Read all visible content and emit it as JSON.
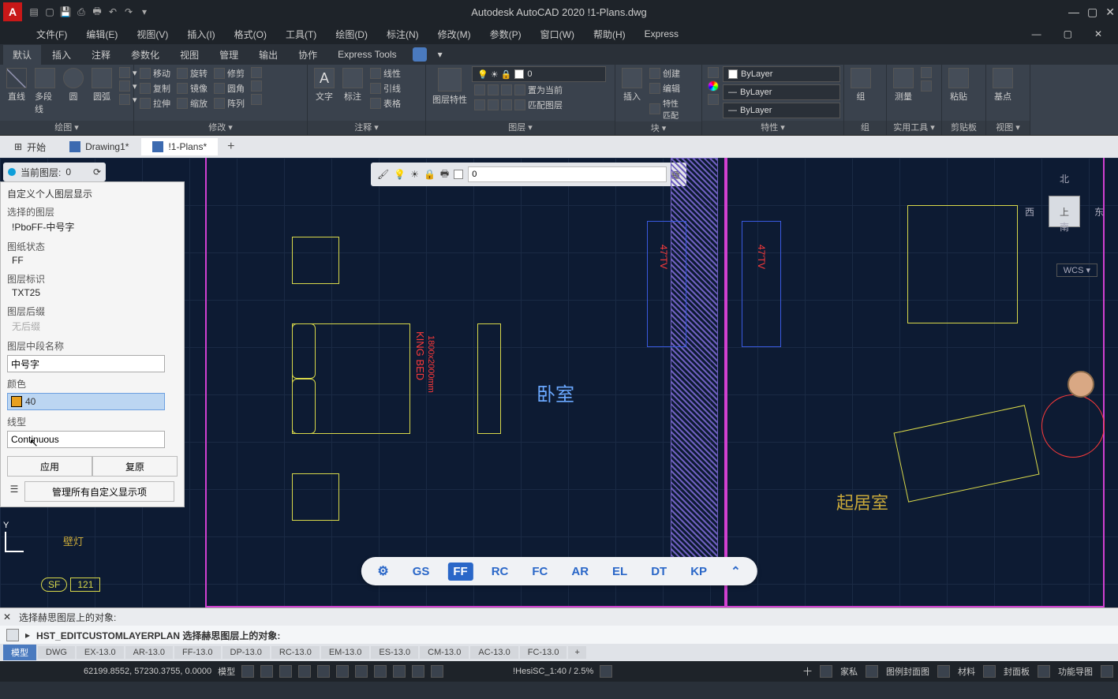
{
  "app": {
    "title": "Autodesk AutoCAD 2020   !1-Plans.dwg"
  },
  "menu": {
    "items": [
      "文件(F)",
      "编辑(E)",
      "视图(V)",
      "插入(I)",
      "格式(O)",
      "工具(T)",
      "绘图(D)",
      "标注(N)",
      "修改(M)",
      "参数(P)",
      "窗口(W)",
      "帮助(H)",
      "Express"
    ]
  },
  "ribbonTabs": [
    "默认",
    "插入",
    "注释",
    "参数化",
    "视图",
    "管理",
    "输出",
    "协作",
    "Express Tools"
  ],
  "panels": {
    "draw": {
      "label": "绘图 ▾",
      "items": [
        "直线",
        "多段线",
        "圆",
        "圆弧"
      ]
    },
    "modify": {
      "label": "修改 ▾",
      "items": [
        "移动",
        "复制",
        "拉伸",
        "旋转",
        "镜像",
        "缩放",
        "修剪",
        "圆角",
        "阵列"
      ]
    },
    "annot": {
      "label": "注释 ▾",
      "items": [
        "文字",
        "标注",
        "线性",
        "引线",
        "表格"
      ]
    },
    "layers": {
      "label": "图层 ▾",
      "current": "0",
      "item1": "置为当前",
      "item2": "匹配图层",
      "props": "图层特性"
    },
    "block": {
      "label": "块 ▾",
      "items": [
        "插入",
        "创建",
        "编辑",
        "特性匹配"
      ]
    },
    "props": {
      "label": "特性 ▾",
      "bylayer": "ByLayer"
    },
    "group": {
      "label": "组",
      "item": "组"
    },
    "utils": {
      "label": "实用工具 ▾",
      "item": "测量"
    },
    "clip": {
      "label": "剪贴板",
      "item": "粘贴"
    },
    "view": {
      "label": "视图 ▾",
      "item": "基点"
    }
  },
  "doctabs": {
    "start": "开始",
    "t1": "Drawing1*",
    "t2": "!1-Plans*"
  },
  "layerstate": {
    "label": "当前图层:",
    "value": "0"
  },
  "minibar": {
    "value": "0"
  },
  "sidepanel": {
    "title": "自定义个人图层显示",
    "l_selected": "选择的图层",
    "v_selected": "!PboFF-中号字",
    "l_paper": "图纸状态",
    "v_paper": "FF",
    "l_layerid": "图层标识",
    "v_layerid": "TXT25",
    "l_suffix": "图层后缀",
    "v_suffix": "无后缀",
    "l_midname": "图层中段名称",
    "v_midname": "中号字",
    "l_color": "颜色",
    "v_color": "40",
    "l_ltype": "线型",
    "v_ltype": "Continuous",
    "btn_apply": "应用",
    "btn_restore": "复原",
    "btn_manage": "管理所有自定义显示项"
  },
  "viewcube": {
    "n": "北",
    "s": "南",
    "e": "东",
    "w": "西",
    "top": "上",
    "wcs": "WCS ▾"
  },
  "rooms": {
    "bedroom": "卧室",
    "living": "起居室",
    "lamp": "壁灯"
  },
  "bed": {
    "title": "KING BED",
    "size": "1800x2000mm"
  },
  "tv": "47'TV",
  "sf_label": "SF",
  "sf_num": "121",
  "pillbar": {
    "items": [
      "GS",
      "FF",
      "RC",
      "FC",
      "AR",
      "EL",
      "DT",
      "KP"
    ],
    "activeIndex": 1
  },
  "cmd": {
    "hist": "选择赫思图层上的对象:",
    "line": "HST_EDITCUSTOMLAYERPLAN 选择赫思图层上的对象:"
  },
  "modeltabs": [
    "模型",
    "DWG",
    "EX-13.0",
    "AR-13.0",
    "FF-13.0",
    "DP-13.0",
    "RC-13.0",
    "EM-13.0",
    "ES-13.0",
    "CM-13.0",
    "AC-13.0",
    "FC-13.0"
  ],
  "status": {
    "coords": "62199.8552, 57230.3755, 0.0000",
    "model": "模型",
    "scale": "!HesiSC_1:40 / 2.5%",
    "right": [
      "十",
      "家私",
      "图例封面图",
      "材料",
      "封面板",
      "功能导图"
    ]
  }
}
